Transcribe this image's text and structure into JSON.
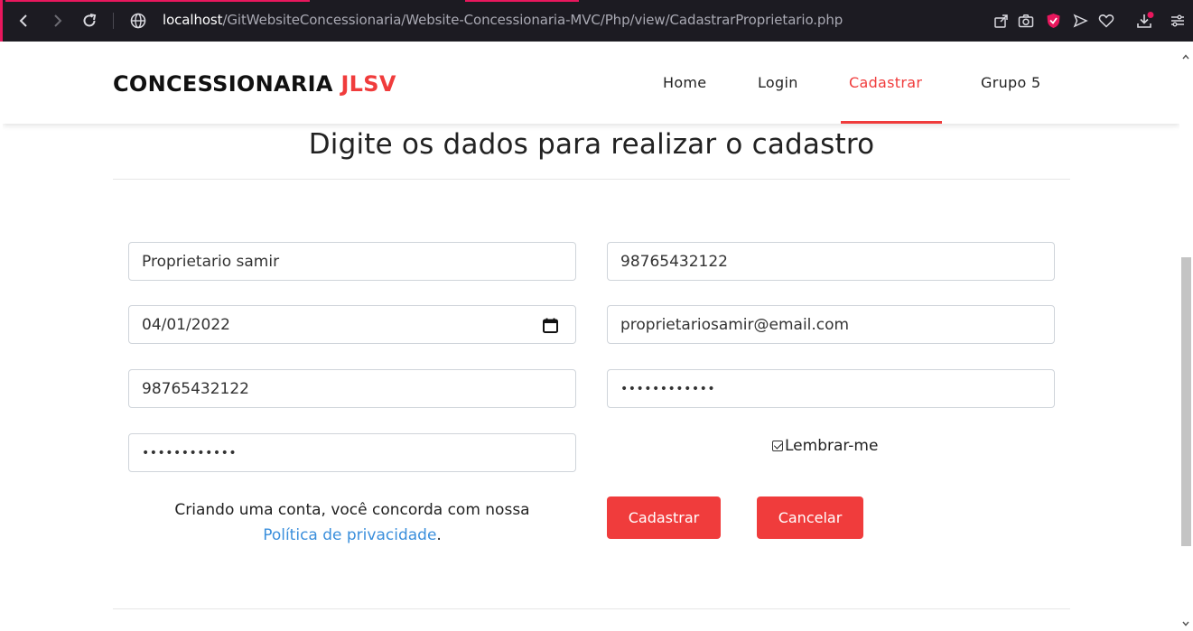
{
  "browser": {
    "url_host": "localhost",
    "url_path": "/GitWebsiteConcessionaria/Website-Concessionaria-MVC/Php/view/CadastrarProprietario.php",
    "accent_color": "#e8175d",
    "icons": [
      "back-icon",
      "forward-icon",
      "reload-icon",
      "site-info-icon",
      "share-icon",
      "camera-icon",
      "shield-icon",
      "send-icon",
      "heart-icon",
      "download-icon",
      "menu-icon"
    ]
  },
  "site": {
    "brand_main": "CONCESSIONARIA ",
    "brand_accent": "JLSV",
    "accent_color": "#f03c3c",
    "nav": {
      "home": "Home",
      "login": "Login",
      "cadastrar": "Cadastrar",
      "grupo": "Grupo 5"
    }
  },
  "form": {
    "heading": "Digite os dados para realizar o cadastro",
    "name_value": "Proprietario samir",
    "cpf_value": "98765432122",
    "date_value": "04/01/2022",
    "email_value": "proprietariosamir@email.com",
    "phone_value": "98765432122",
    "password_value": "••••••••••••",
    "password_confirm_value": "••••••••••••",
    "remember_label": "Lembrar-me",
    "remember_checked": true,
    "terms_text": "Criando uma conta, você concorda com nossa",
    "privacy_link": "Política de privacidade",
    "terms_end": ".",
    "submit_label": "Cadastrar",
    "cancel_label": "Cancelar"
  }
}
